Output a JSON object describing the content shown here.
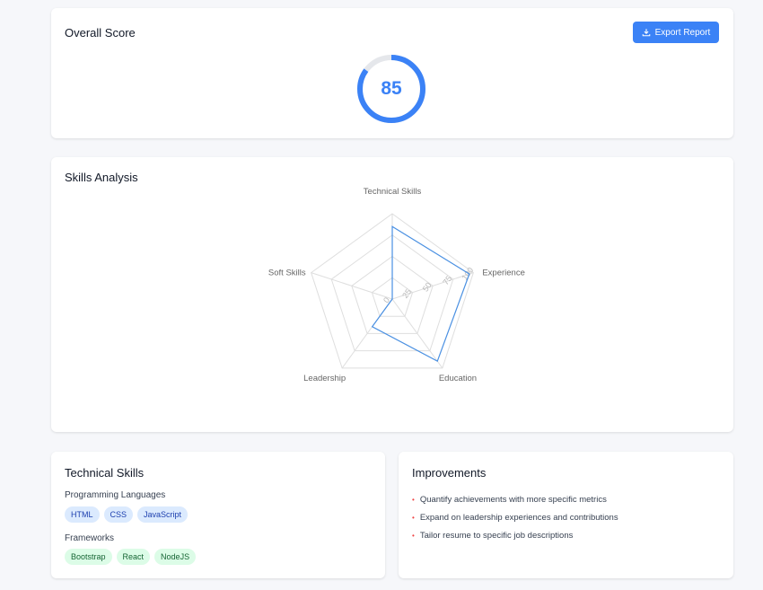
{
  "score_card": {
    "title": "Overall Score",
    "export_label": "Export Report",
    "score": 85,
    "score_text": "85",
    "accent": "#3b82f6"
  },
  "skills_card": {
    "title": "Skills Analysis",
    "chart_data": {
      "type": "radar",
      "axes": [
        "Technical Skills",
        "Experience",
        "Education",
        "Leadership",
        "Soft Skills"
      ],
      "values": [
        85,
        95,
        90,
        40,
        0
      ],
      "range": [
        0,
        100
      ],
      "ticks": [
        0,
        25,
        50,
        75,
        100
      ],
      "tick_labels": [
        "0",
        "25",
        "50",
        "75",
        "100"
      ],
      "series_color": "#4a90e2",
      "grid": true
    }
  },
  "tech_card": {
    "title": "Technical Skills",
    "groups": [
      {
        "label": "Programming Languages",
        "tags": [
          "HTML",
          "CSS",
          "JavaScript"
        ],
        "color": "blue"
      },
      {
        "label": "Frameworks",
        "tags": [
          "Bootstrap",
          "React",
          "NodeJS"
        ],
        "color": "green"
      }
    ]
  },
  "improvements_card": {
    "title": "Improvements",
    "items": [
      "Quantify achievements with more specific metrics",
      "Expand on leadership experiences and contributions",
      "Tailor resume to specific job descriptions"
    ]
  }
}
